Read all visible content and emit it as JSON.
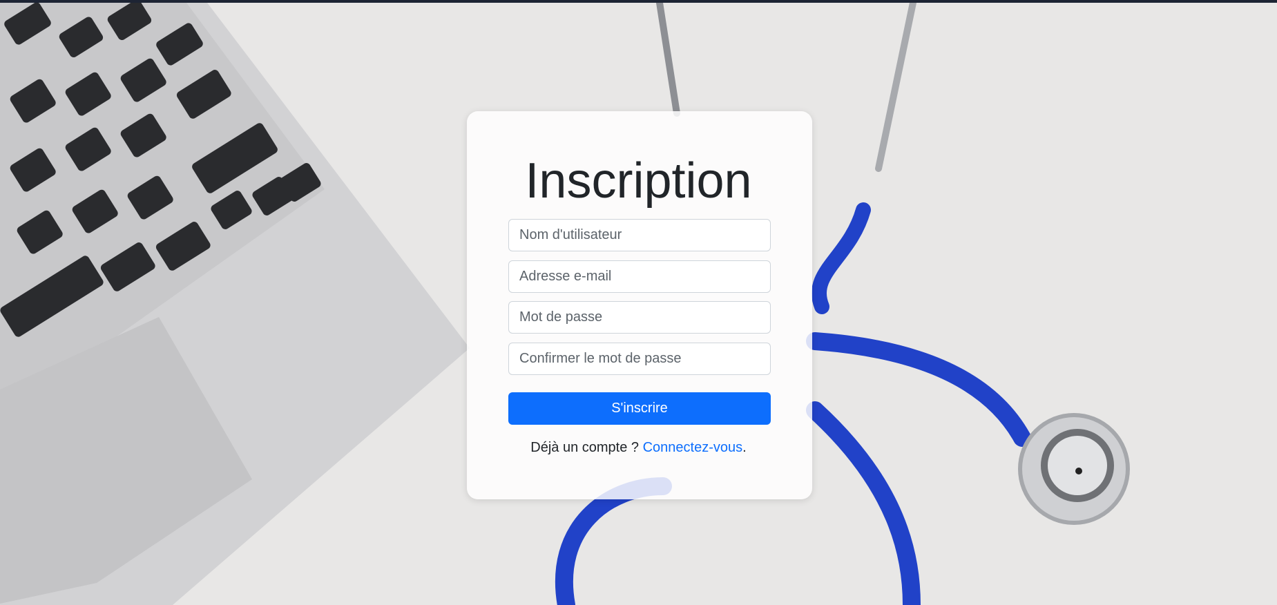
{
  "page": {
    "title": "Inscription"
  },
  "form": {
    "username_placeholder": "Nom d'utilisateur",
    "email_placeholder": "Adresse e-mail",
    "password_placeholder": "Mot de passe",
    "confirm_password_placeholder": "Confirmer le mot de passe",
    "submit_label": "S'inscrire"
  },
  "login_prompt": {
    "text": "Déjà un compte ?",
    "link_label": "Connectez-vous",
    "suffix": "."
  },
  "colors": {
    "primary": "#0d6efd",
    "background": "#e7e6e6",
    "stethoscope_tube": "#1f44c4",
    "laptop_body": "#d4d4d6",
    "keys": "#27282b"
  },
  "background_image": {
    "icons": [
      "laptop-icon",
      "stethoscope-icon"
    ]
  }
}
